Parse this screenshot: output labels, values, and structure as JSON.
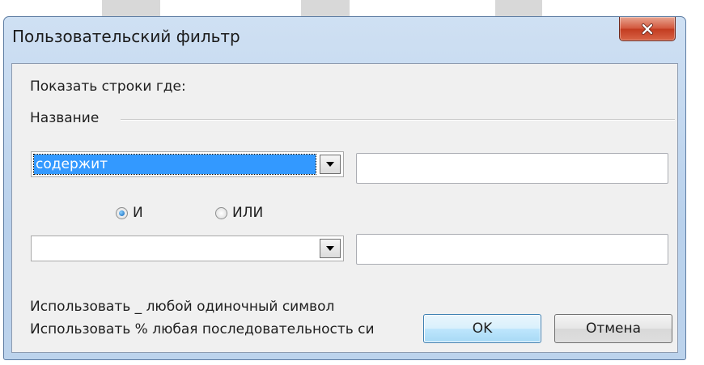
{
  "window": {
    "title": "Пользовательский фильтр"
  },
  "icons": {
    "close": "close-icon",
    "dropdown": "chevron-down-icon"
  },
  "colors": {
    "selection": "#3399ff",
    "client_bg": "#f0f0f0",
    "close_button": "#c94a30"
  },
  "filter": {
    "prompt": "Показать строки где:",
    "field_name": "Название",
    "condition1": {
      "operator": "содержит",
      "value": ""
    },
    "logic": {
      "and_label": "И",
      "or_label": "ИЛИ",
      "selected": "and"
    },
    "condition2": {
      "operator": "",
      "value": ""
    }
  },
  "hints": {
    "underscore": "Использовать _ любой одиночный символ",
    "percent": "Использовать % любая последовательность си"
  },
  "buttons": {
    "ok": "OK",
    "cancel": "Отмена"
  }
}
